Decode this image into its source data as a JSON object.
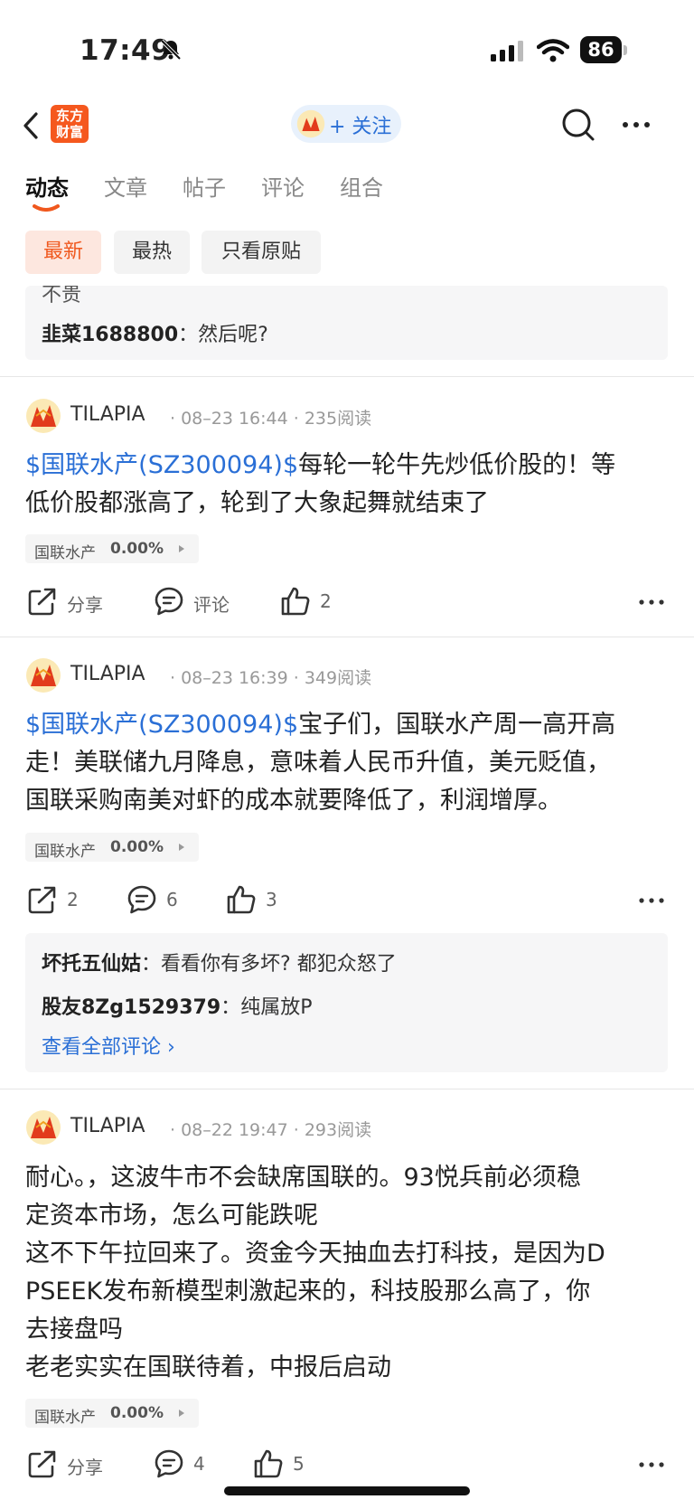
{
  "status_bar": {
    "time": "17:49",
    "battery": "86"
  },
  "nav": {
    "logo_text_line1": "东方",
    "logo_text_line2": "财富",
    "follow_label": "+ 关注"
  },
  "tabs": [
    {
      "label": "动态",
      "active": true
    },
    {
      "label": "文章"
    },
    {
      "label": "帖子"
    },
    {
      "label": "评论"
    },
    {
      "label": "组合"
    }
  ],
  "filters": [
    {
      "label": "最新",
      "active": true
    },
    {
      "label": "最热"
    },
    {
      "label": "只看原贴"
    }
  ],
  "top_comment_box": {
    "partial_text": "不贵",
    "comments": [
      {
        "user": "韭菜1688800",
        "text": "然后呢?"
      }
    ]
  },
  "posts": [
    {
      "author": "TILAPIA",
      "meta": "· 08–23 16:44 · 235阅读",
      "tag": "$国联水产(SZ300094)$",
      "lines": [
        "每轮一轮牛先炒低价股的！等",
        "低价股都涨高了，轮到了大象起舞就结束了"
      ],
      "stock": {
        "name": "国联水产",
        "change": "0.00%"
      },
      "actions": {
        "share": "分享",
        "comment": "评论",
        "like": "2"
      }
    },
    {
      "author": "TILAPIA",
      "meta": "· 08–23 16:39 · 349阅读",
      "tag": "$国联水产(SZ300094)$",
      "lines": [
        "宝子们，国联水产周一高开高",
        "走！美联储九月降息，意味着人民币升值，美元贬值，",
        "国联采购南美对虾的成本就要降低了，利润增厚。"
      ],
      "stock": {
        "name": "国联水产",
        "change": "0.00%"
      },
      "actions": {
        "share": "2",
        "comment": "6",
        "like": "3"
      },
      "comments": [
        {
          "user": "坏托五仙姑",
          "text": "看看你有多坏? 都犯众怒了"
        },
        {
          "user": "股友8Zg1529379",
          "text": "纯属放P"
        }
      ],
      "view_all": "查看全部评论 ›"
    },
    {
      "author": "TILAPIA",
      "meta": "· 08–22 19:47 · 293阅读",
      "lines": [
        "耐心。，这波牛市不会缺席国联的。93悦兵前必须稳",
        "定资本市场，怎么可能跌呢",
        "这不下午拉回来了。资金今天抽血去打科技，是因为D",
        "PSEEK发布新模型刺激起来的，科技股那么高了，你",
        "去接盘吗",
        "老老实实在国联待着，中报后启动"
      ],
      "stock": {
        "name": "国联水产",
        "change": "0.00%"
      },
      "actions": {
        "share": "分享",
        "comment": "4",
        "like": "5"
      }
    }
  ]
}
